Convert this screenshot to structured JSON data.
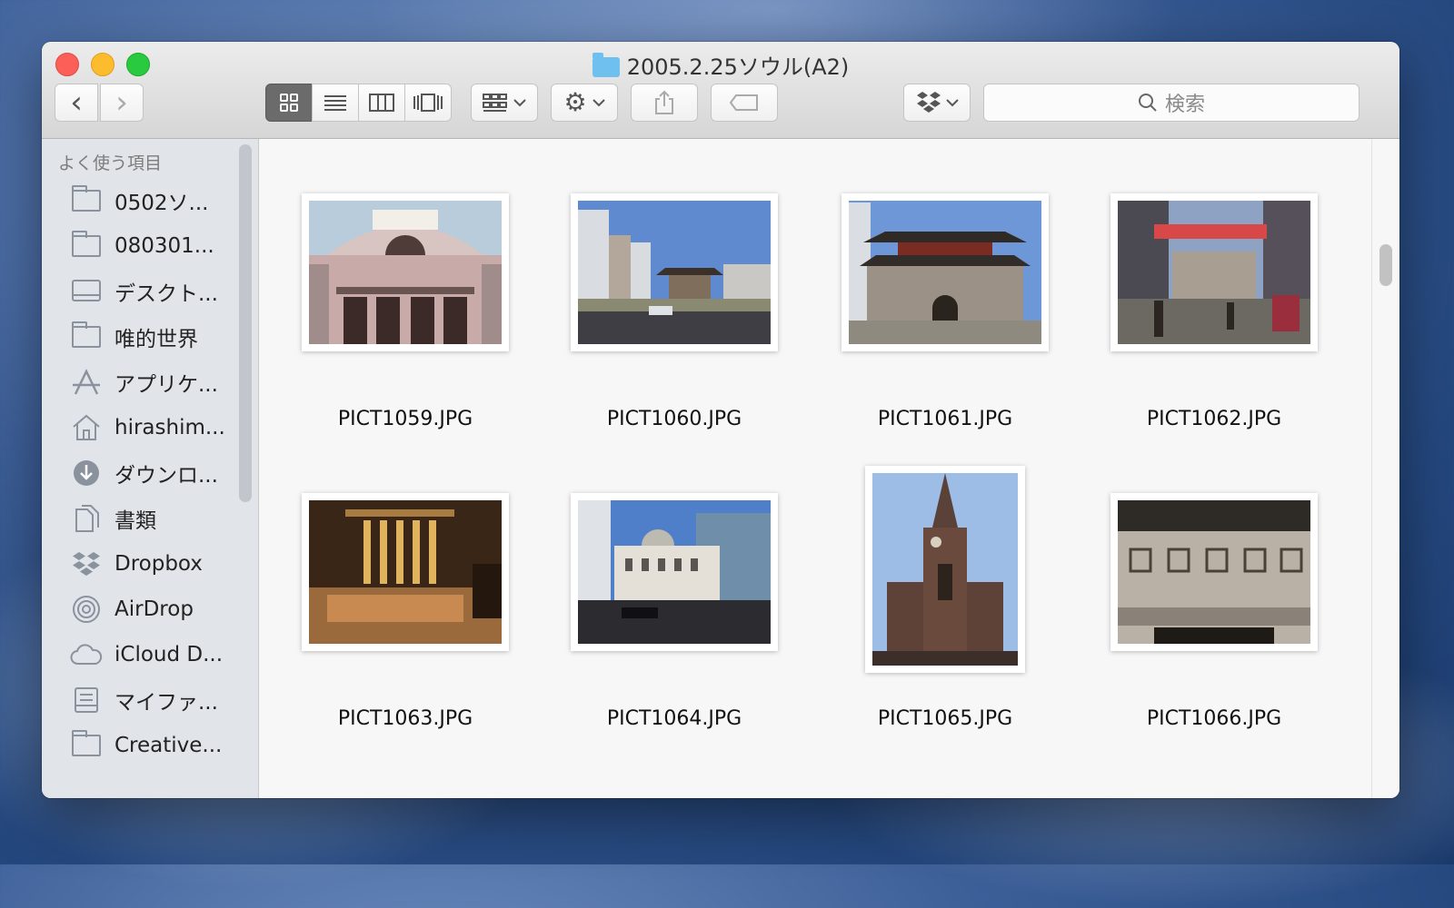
{
  "window": {
    "title": "2005.2.25ソウル(A2)",
    "controls": [
      "close",
      "minimize",
      "zoom"
    ]
  },
  "toolbar": {
    "back_icon": "‹",
    "forward_icon": "›",
    "views": [
      "icon-view",
      "list-view",
      "column-view",
      "cover-flow-view"
    ],
    "arrange_icon": "arrange-icon",
    "action_icon": "gear-icon",
    "share_icon": "share-icon",
    "tag_icon": "tag-icon",
    "dropbox_icon": "dropbox-icon",
    "search_placeholder": "検索"
  },
  "sidebar": {
    "section": "よく使う項目",
    "items": [
      {
        "label": "0502ソ...",
        "icon": "folder-icon"
      },
      {
        "label": "080301...",
        "icon": "folder-icon"
      },
      {
        "label": "デスクト...",
        "icon": "desktop-icon"
      },
      {
        "label": "唯的世界",
        "icon": "folder-icon"
      },
      {
        "label": "アプリケ...",
        "icon": "applications-icon"
      },
      {
        "label": "hirashim...",
        "icon": "home-icon"
      },
      {
        "label": "ダウンロ...",
        "icon": "download-icon"
      },
      {
        "label": "書類",
        "icon": "documents-icon"
      },
      {
        "label": "Dropbox",
        "icon": "dropbox-icon"
      },
      {
        "label": "AirDrop",
        "icon": "airdrop-icon"
      },
      {
        "label": "iCloud D...",
        "icon": "cloud-icon"
      },
      {
        "label": "マイファ...",
        "icon": "all-files-icon"
      },
      {
        "label": "Creative...",
        "icon": "folder-icon"
      }
    ]
  },
  "files": [
    {
      "name": "PICT1059.JPG",
      "subject": "Seoul Station building"
    },
    {
      "name": "PICT1060.JPG",
      "subject": "street with city gate"
    },
    {
      "name": "PICT1061.JPG",
      "subject": "Namdaemun gate"
    },
    {
      "name": "PICT1062.JPG",
      "subject": "market street"
    },
    {
      "name": "PICT1063.JPG",
      "subject": "market stall"
    },
    {
      "name": "PICT1064.JPG",
      "subject": "domed stone building"
    },
    {
      "name": "PICT1065.JPG",
      "subject": "cathedral tower"
    },
    {
      "name": "PICT1066.JPG",
      "subject": "building facade lettering"
    }
  ]
}
